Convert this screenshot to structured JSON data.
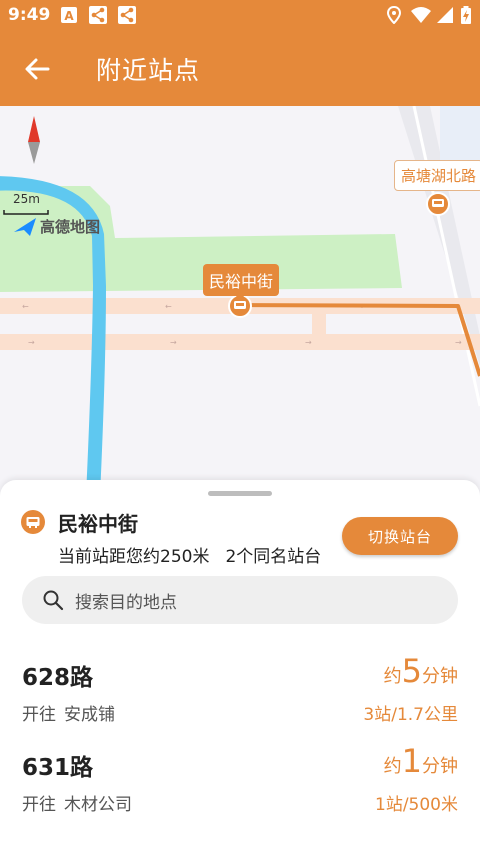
{
  "status_bar": {
    "time": "9:49",
    "icons": [
      "app-a-icon",
      "share-icon",
      "share-icon",
      "location-icon",
      "wifi-icon",
      "signal-icon",
      "battery-icon"
    ]
  },
  "app_bar": {
    "title": "附近站点",
    "back_icon": "arrow-left-icon"
  },
  "map": {
    "scale_label": "25m",
    "logo_text": "高德地图",
    "stop_label": "民裕中街",
    "road_label": "高塘湖北路",
    "compass_icon": "compass-icon"
  },
  "stop": {
    "name": "民裕中街",
    "distance_text": "当前站距您约250米",
    "same_name_text": "2个同名站台",
    "switch_label": "切换站台"
  },
  "search": {
    "placeholder": "搜索目的地点"
  },
  "routes": [
    {
      "number": "628路",
      "toward_prefix": "开往",
      "destination": "安成铺",
      "eta_prefix": "约",
      "eta_value": "5",
      "eta_unit": "分钟",
      "meta": "3站/1.7公里"
    },
    {
      "number": "631路",
      "toward_prefix": "开往",
      "destination": "木材公司",
      "eta_prefix": "约",
      "eta_value": "1",
      "eta_unit": "分钟",
      "meta": "1站/500米"
    }
  ],
  "colors": {
    "accent": "#e5893a",
    "water": "#5fc8f0",
    "park": "#cdf0c4",
    "road": "#fbe0cf"
  }
}
